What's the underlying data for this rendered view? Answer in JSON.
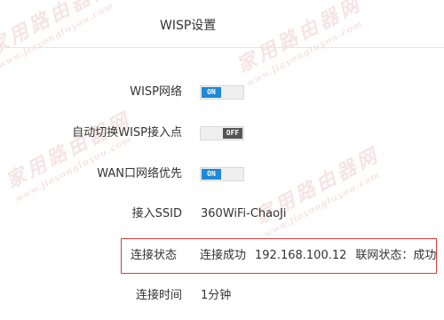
{
  "page": {
    "title": "WISP设置"
  },
  "watermark": {
    "cn": "家用路由器网",
    "en": "www.jiayongluyou.com"
  },
  "settings": {
    "wisp": {
      "label": "WISP网络",
      "state": "ON"
    },
    "auto_switch": {
      "label": "自动切换WISP接入点",
      "state": "OFF"
    },
    "wan_priority": {
      "label": "WAN口网络优先",
      "state": "ON"
    },
    "ssid": {
      "label": "接入SSID",
      "value": "360WiFi-ChaoJi"
    },
    "status": {
      "label": "连接状态",
      "result": "连接成功",
      "ip": "192.168.100.12",
      "internet": "联网状态：成功"
    },
    "duration": {
      "label": "连接时间",
      "value": "1分钟"
    }
  },
  "colors": {
    "accent": "#1e88d9",
    "toggle_off": "#555555",
    "highlight_border": "#e03b3b"
  }
}
